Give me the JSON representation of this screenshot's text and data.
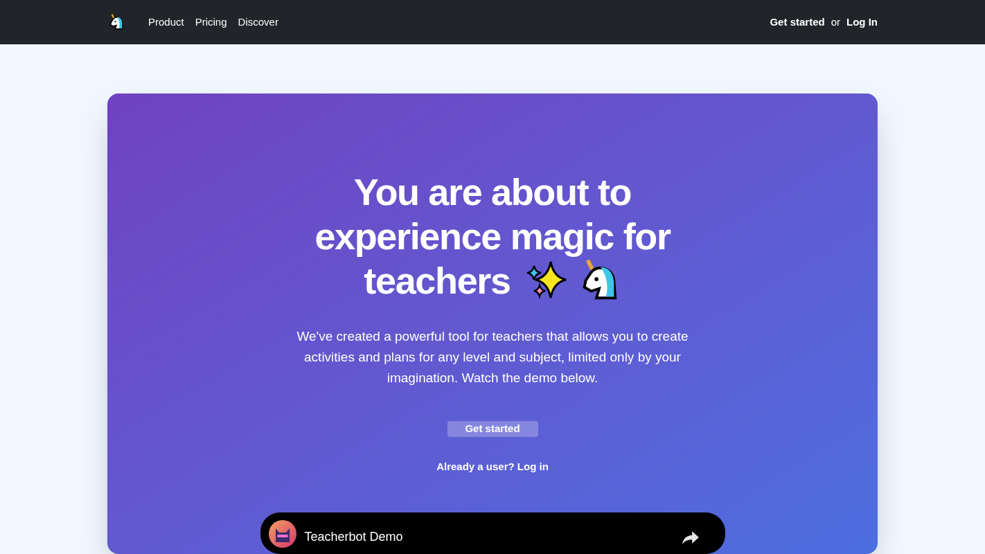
{
  "nav": {
    "links": [
      "Product",
      "Pricing",
      "Discover"
    ],
    "get_started": "Get started",
    "or": "or",
    "log_in": "Log In"
  },
  "hero": {
    "title_lines": [
      "You are about to",
      "experience magic for",
      "teachers"
    ],
    "description": "We've created a powerful tool for teachers that allows you to create activities and plans for any level and subject, limited only by your imagination. Watch the demo below.",
    "button": "Get started",
    "login_link": "Already a user? Log in"
  },
  "video": {
    "title": "Teacherbot Demo"
  }
}
